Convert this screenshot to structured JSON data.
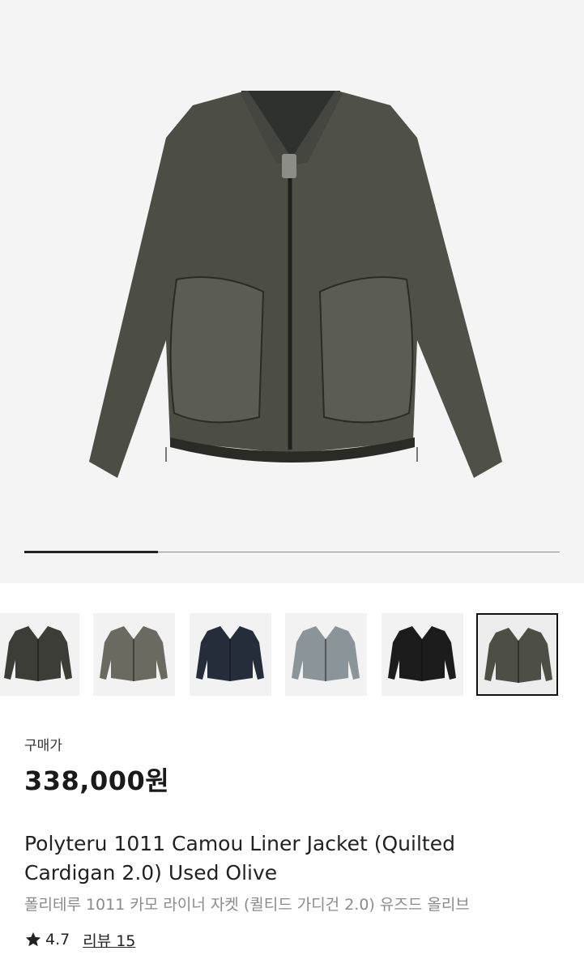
{
  "product": {
    "image_name": "olive-liner-jacket-photo",
    "gallery_progress": 0.25,
    "thumbnails": [
      {
        "label": "dark-olive-jacket",
        "color": "#3b3d36",
        "selected": false
      },
      {
        "label": "grey-olive-jacket",
        "color": "#6a6a61",
        "selected": false
      },
      {
        "label": "navy-jacket",
        "color": "#252c3a",
        "selected": false
      },
      {
        "label": "light-grey-quilted-jacket",
        "color": "#8b9498",
        "selected": false
      },
      {
        "label": "black-jacket",
        "color": "#1c1c1c",
        "selected": false
      },
      {
        "label": "used-olive-jacket",
        "color": "#4d4e46",
        "selected": true
      }
    ],
    "price_label": "구매가",
    "price": "338,000원",
    "title_en": "Polyteru 1011 Camou Liner Jacket (Quilted Cardigan 2.0) Used Olive",
    "title_ko": "폴리테루 1011 카모 라이너 자켓 (퀼티드 가디건 2.0) 유즈드 올리브",
    "rating": "4.7",
    "reviews": "리뷰 15"
  }
}
